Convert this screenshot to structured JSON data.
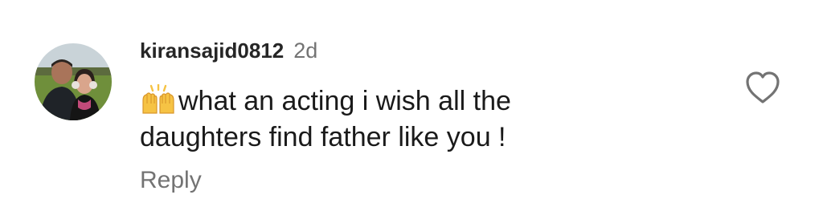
{
  "comment": {
    "username": "kiransajid0812",
    "time": "2d",
    "text_line1": "what an acting i wish all the",
    "text_line2": "daughters find father like you !",
    "emoji": "raising-hands-emoji",
    "reply_label": "Reply",
    "like_icon": "heart-outline-icon"
  },
  "colors": {
    "username": "#262626",
    "secondary_text": "#737373",
    "body_text": "#1a1a1a",
    "emoji": "#f6c344"
  }
}
